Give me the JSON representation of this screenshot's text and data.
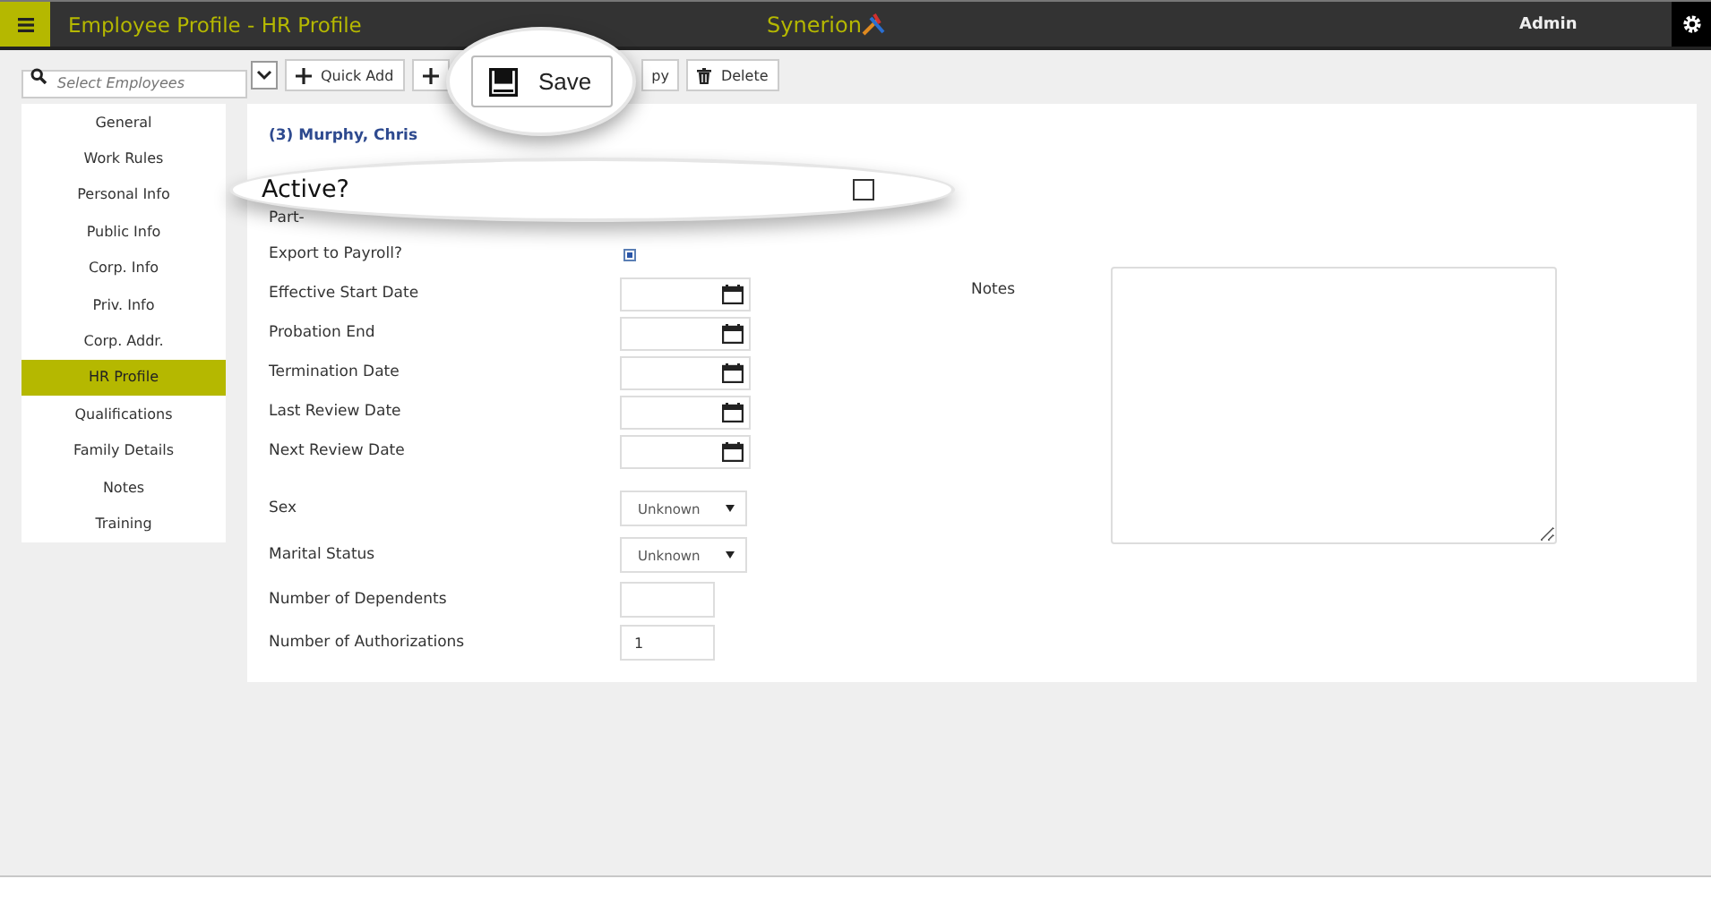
{
  "header": {
    "title": "Employee Profile - HR Profile",
    "logo": "Synerion",
    "user": "Admin"
  },
  "toolbar": {
    "search_placeholder": "Select Employees",
    "buttons": [
      {
        "kind": "quick_add",
        "label": "Quick Add"
      },
      {
        "kind": "add"
      },
      {
        "kind": "gap"
      },
      {
        "kind": "text",
        "label": "py"
      },
      {
        "kind": "delete",
        "label": "Delete"
      }
    ]
  },
  "save_callout": {
    "label": "Save"
  },
  "sidebar": [
    {
      "label": "General",
      "selected": false
    },
    {
      "label": "Work Rules",
      "selected": false
    },
    {
      "label": "Personal Info",
      "selected": false
    },
    {
      "label": "Public Info",
      "selected": false
    },
    {
      "label": "Corp. Info",
      "selected": false
    },
    {
      "label": "Priv. Info",
      "selected": false
    },
    {
      "label": "Corp. Addr.",
      "selected": false
    },
    {
      "label": "HR Profile",
      "selected": true
    },
    {
      "label": "Qualifications",
      "selected": false
    },
    {
      "label": "Family Details",
      "selected": false
    },
    {
      "label": "Notes",
      "selected": false
    },
    {
      "label": "Training",
      "selected": false
    }
  ],
  "employee": "(3) Murphy, Chris",
  "active_callout": {
    "label": "Active?",
    "checked": false
  },
  "fields": [
    {
      "kind": "label",
      "label": "Part-"
    },
    {
      "kind": "checkbox",
      "label": "Export to Payroll?",
      "checked": true
    },
    {
      "kind": "date",
      "label": "Effective Start Date"
    },
    {
      "kind": "date",
      "label": "Probation End"
    },
    {
      "kind": "date",
      "label": "Termination Date"
    },
    {
      "kind": "date",
      "label": "Last Review Date"
    },
    {
      "kind": "date",
      "label": "Next Review Date"
    },
    {
      "kind": "select",
      "label": "Sex",
      "value": "Unknown"
    },
    {
      "kind": "select",
      "label": "Marital Status",
      "value": "Unknown"
    },
    {
      "kind": "number",
      "label": "Number of Dependents"
    },
    {
      "kind": "number",
      "label": "Number of Authorizations",
      "value": "1"
    }
  ],
  "notes": {
    "label": "Notes"
  }
}
